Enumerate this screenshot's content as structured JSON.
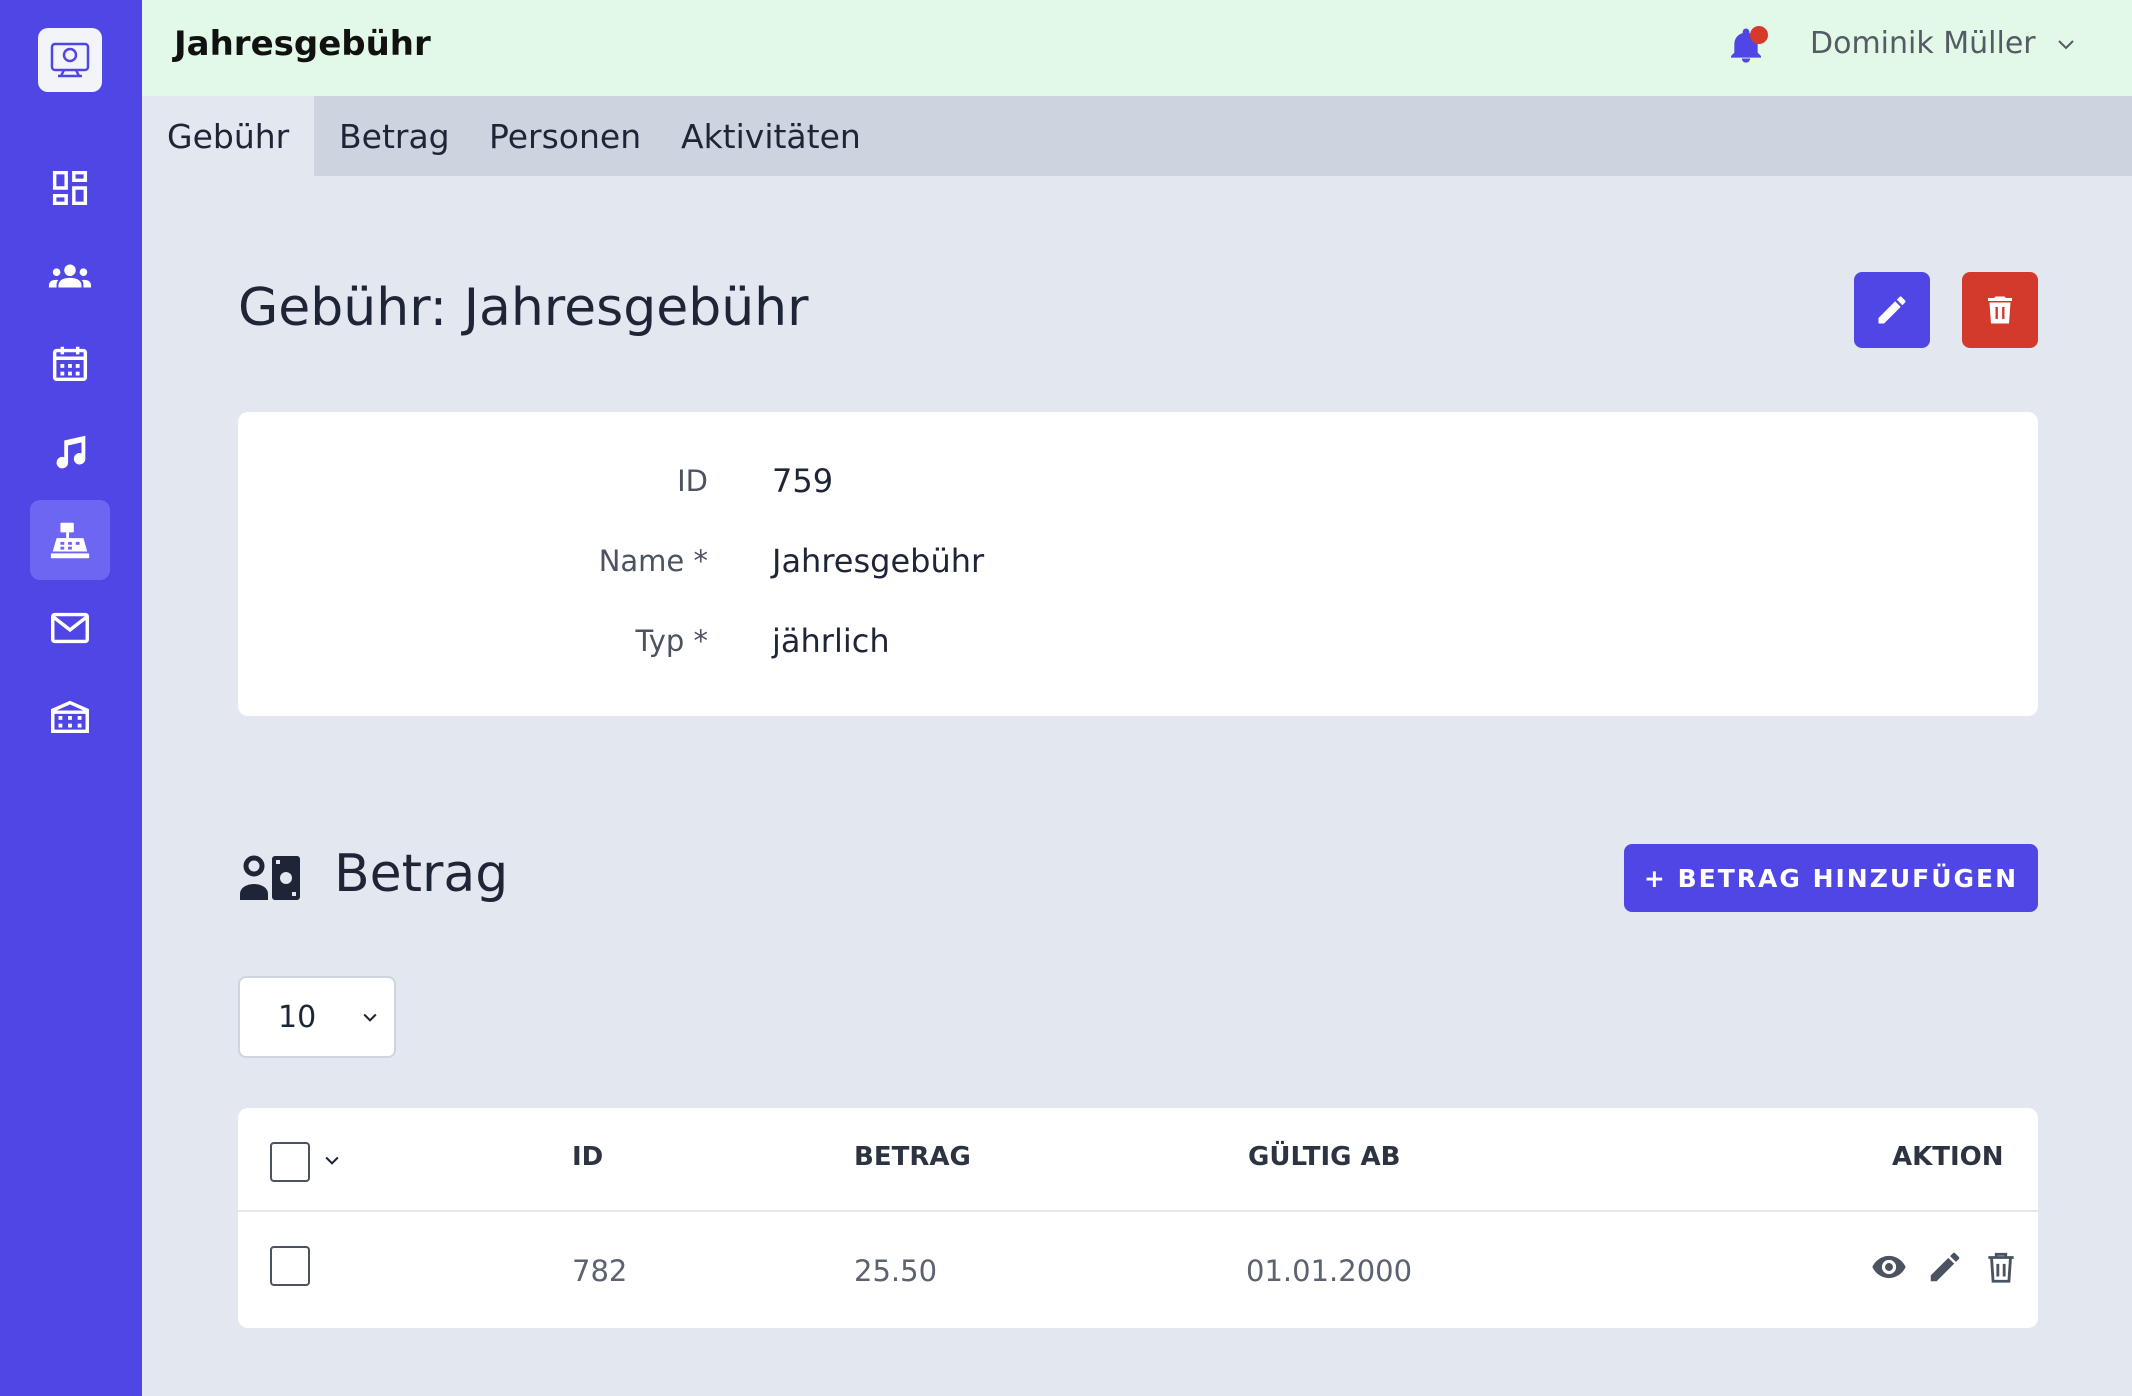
{
  "app": {
    "title": "Jahresgebühr"
  },
  "user": {
    "name": "Dominik Müller"
  },
  "sidebar": {
    "items": [
      {
        "icon": "dashboard-icon",
        "active": false
      },
      {
        "icon": "people-icon",
        "active": false
      },
      {
        "icon": "calendar-icon",
        "active": false
      },
      {
        "icon": "music-note-icon",
        "active": false
      },
      {
        "icon": "cash-register-icon",
        "active": true
      },
      {
        "icon": "mail-icon",
        "active": false
      },
      {
        "icon": "building-icon",
        "active": false
      }
    ]
  },
  "tabs": [
    {
      "label": "Gebühr",
      "active": true
    },
    {
      "label": "Betrag",
      "active": false
    },
    {
      "label": "Personen",
      "active": false
    },
    {
      "label": "Aktivitäten",
      "active": false
    }
  ],
  "page": {
    "title": "Gebühr: Jahresgebühr"
  },
  "details": {
    "fields": [
      {
        "label": "ID",
        "value": "759"
      },
      {
        "label": "Name *",
        "value": "Jahresgebühr"
      },
      {
        "label": "Typ *",
        "value": "jährlich"
      }
    ]
  },
  "betrag_section": {
    "title": "Betrag",
    "add_button": "+ BETRAG HINZUFÜGEN",
    "page_size": "10",
    "columns": [
      "ID",
      "BETRAG",
      "GÜLTIG AB",
      "AKTION"
    ],
    "rows": [
      {
        "id": "782",
        "betrag": "25.50",
        "gueltig_ab": "01.01.2000"
      }
    ]
  },
  "colors": {
    "primary": "#4f46e5",
    "danger": "#d43a2c",
    "topbar": "#e3f9e8",
    "background": "#e3e7f0"
  }
}
